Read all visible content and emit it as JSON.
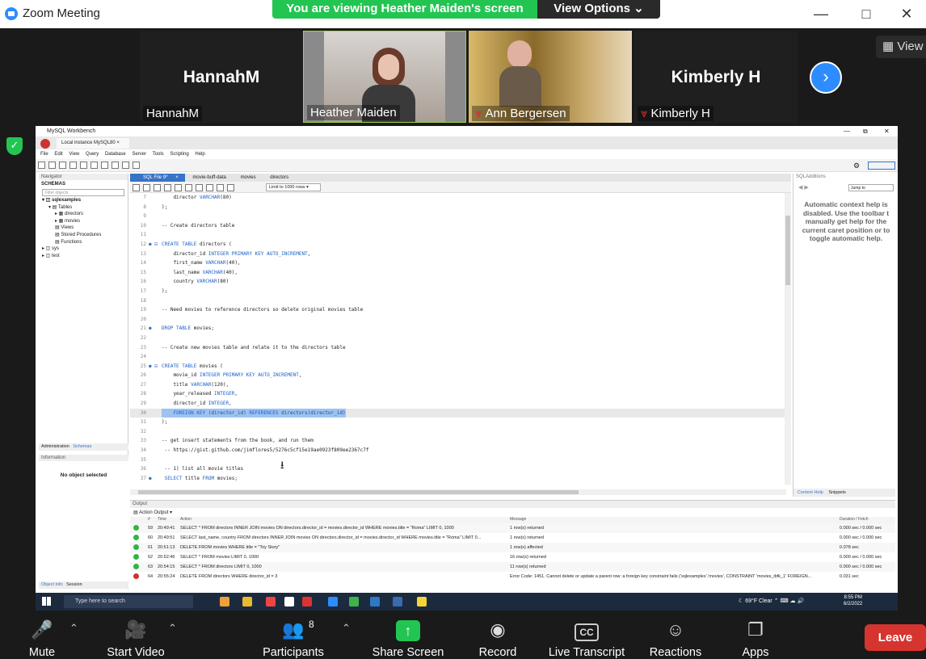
{
  "zoom": {
    "window_title": "Zoom Meeting",
    "viewing_banner": "You are viewing Heather Maiden's screen",
    "view_options": "View Options",
    "view_button": "View",
    "participants": [
      {
        "big_name": "HannahM",
        "name": "HannahM",
        "muted": false
      },
      {
        "big_name": "",
        "name": "Heather Maiden",
        "muted": false
      },
      {
        "big_name": "",
        "name": "Ann Bergersen",
        "muted": true
      },
      {
        "big_name": "Kimberly H",
        "name": "Kimberly H",
        "muted": true
      }
    ],
    "toolbar": {
      "mute": "Mute",
      "start_video": "Start Video",
      "participants": "Participants",
      "participants_count": "8",
      "share_screen": "Share Screen",
      "record": "Record",
      "live_transcript": "Live Transcript",
      "reactions": "Reactions",
      "apps": "Apps",
      "leave": "Leave"
    }
  },
  "workbench": {
    "title": "MySQL Workbench",
    "instance_tab": "Local instance MySQL80",
    "menu": [
      "File",
      "Edit",
      "View",
      "Query",
      "Database",
      "Server",
      "Tools",
      "Scripting",
      "Help"
    ],
    "navigator": {
      "header": "Navigator",
      "schemas_label": "SCHEMAS",
      "filter_placeholder": "Filter objects",
      "tree": [
        "sqlexamples",
        "Tables",
        "directors",
        "movies",
        "Views",
        "Stored Procedures",
        "Functions",
        "sys",
        "test"
      ]
    },
    "editor_tabs": [
      "SQL File 9*",
      "movie-buff-data",
      "movies",
      "directors"
    ],
    "limit_select": "Limit to 1000 rows",
    "code_lines": [
      {
        "n": "7",
        "t": "    director VARCHAR(80)"
      },
      {
        "n": "8",
        "t": ");"
      },
      {
        "n": "9",
        "t": ""
      },
      {
        "n": "10",
        "t": "-- Create directors table"
      },
      {
        "n": "11",
        "t": ""
      },
      {
        "n": "12",
        "t": "CREATE TABLE directors ("
      },
      {
        "n": "13",
        "t": "    director_id INTEGER PRIMARY KEY AUTO_INCREMENT,"
      },
      {
        "n": "14",
        "t": "    first_name VARCHAR(40),"
      },
      {
        "n": "15",
        "t": "    last_name VARCHAR(40),"
      },
      {
        "n": "16",
        "t": "    country VARCHAR(80)"
      },
      {
        "n": "17",
        "t": ");"
      },
      {
        "n": "18",
        "t": ""
      },
      {
        "n": "19",
        "t": "-- Need movies to reference directors so delete original movies table"
      },
      {
        "n": "20",
        "t": ""
      },
      {
        "n": "21",
        "t": "DROP TABLE movies;"
      },
      {
        "n": "22",
        "t": ""
      },
      {
        "n": "23",
        "t": "-- Create new movies table and relate it to the directors table"
      },
      {
        "n": "24",
        "t": ""
      },
      {
        "n": "25",
        "t": "CREATE TABLE movies ("
      },
      {
        "n": "26",
        "t": "    movie_id INTEGER PRIMARY KEY AUTO_INCREMENT,"
      },
      {
        "n": "27",
        "t": "    title VARCHAR(120),"
      },
      {
        "n": "28",
        "t": "    year_released INTEGER,"
      },
      {
        "n": "29",
        "t": "    director_id INTEGER,"
      },
      {
        "n": "30",
        "t": "    FOREIGN KEY (director_id) REFERENCES directors(director_id)"
      },
      {
        "n": "31",
        "t": ");"
      },
      {
        "n": "32",
        "t": ""
      },
      {
        "n": "33",
        "t": "-- get insert statements from the book, and run them"
      },
      {
        "n": "34",
        "t": " -- https://gist.github.com/jimflores5/5276c5cf15e19ae0923f809ee2367c7f"
      },
      {
        "n": "35",
        "t": ""
      },
      {
        "n": "36",
        "t": " -- 1) list all movie titles"
      },
      {
        "n": "37",
        "t": " SELECT title FROM movies;"
      }
    ],
    "sql_additions": {
      "title": "SQLAdditions",
      "jump_to": "Jump to",
      "help_text": "Automatic context help is disabled. Use the toolbar t manually get help for the current caret position or to toggle automatic help.",
      "context_help": "Context Help",
      "snippets": "Snippets"
    },
    "admin_tabs": [
      "Administration",
      "Schemas"
    ],
    "information_header": "Information",
    "no_object": "No object selected",
    "bottom_tabs": [
      "Object Info",
      "Session"
    ],
    "output": {
      "title": "Output",
      "mode": "Action Output",
      "columns": [
        "#",
        "Time",
        "Action",
        "Message",
        "Duration / Fetch"
      ],
      "rows": [
        {
          "n": "59",
          "time": "20:49:41",
          "action": "SELECT * FROM directors INNER JOIN movies ON directors.director_id = movies.director_id  WHERE movies.title = \"Roma\" LIMIT 0, 1000",
          "msg": "1 row(s) returned",
          "dur": "0.000 sec / 0.000 sec",
          "status": "ok"
        },
        {
          "n": "60",
          "time": "20:49:51",
          "action": "SELECT last_name, country FROM directors INNER JOIN movies ON directors.director_id = movies.director_id  WHERE movies.title = \"Roma\" LIMIT 0...",
          "msg": "1 row(s) returned",
          "dur": "0.000 sec / 0.000 sec",
          "status": "ok"
        },
        {
          "n": "61",
          "time": "20:51:13",
          "action": "DELETE FROM movies WHERE title = \"Toy Story\"",
          "msg": "1 row(s) affected",
          "dur": "0.078 sec",
          "status": "ok"
        },
        {
          "n": "62",
          "time": "20:52:46",
          "action": "SELECT * FROM movies LIMIT 0, 1000",
          "msg": "16 row(s) returned",
          "dur": "0.000 sec / 0.000 sec",
          "status": "ok"
        },
        {
          "n": "63",
          "time": "20:54:15",
          "action": "SELECT * FROM directors LIMIT 0, 1000",
          "msg": "11 row(s) returned",
          "dur": "0.000 sec / 0.000 sec",
          "status": "ok"
        },
        {
          "n": "64",
          "time": "20:55:24",
          "action": "DELETE FROM directors WHERE director_id = 3",
          "msg": "Error Code: 1451. Cannot delete or update a parent row: a foreign key constraint fails ('sqlexamples'.'movies', CONSTRAINT 'movies_ibfk_1' FOREIGN...",
          "dur": "0.031 sec",
          "status": "error"
        }
      ]
    }
  },
  "taskbar": {
    "search_placeholder": "Type here to search",
    "weather": "69°F  Clear",
    "time": "8:55 PM",
    "date": "6/2/2022"
  }
}
